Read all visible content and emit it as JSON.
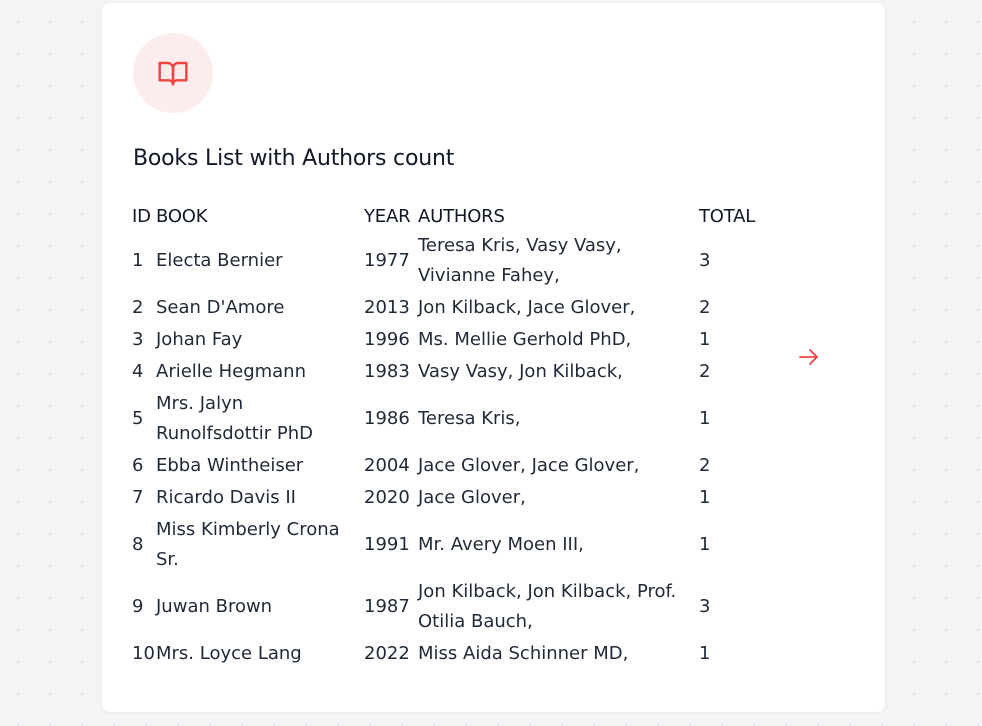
{
  "card": {
    "title": "Books List with Authors count"
  },
  "icons": {
    "header_icon": "book-open-icon",
    "next_icon": "arrow-right-icon"
  },
  "colors": {
    "accent": "#ef4444",
    "icon_bg": "#fdecec",
    "page_bg": "#f3f4f6",
    "card_bg": "#ffffff",
    "text": "#111827"
  },
  "table": {
    "headers": {
      "id": "ID",
      "book": "BOOK",
      "year": "YEAR",
      "authors": "AUTHORS",
      "total": "TOTAL"
    },
    "rows": [
      {
        "id": "1",
        "book": "Electa Bernier",
        "year": "1977",
        "authors": "Teresa Kris, Vasy Vasy, Vivianne Fahey,",
        "total": "3"
      },
      {
        "id": "2",
        "book": "Sean D'Amore",
        "year": "2013",
        "authors": "Jon Kilback, Jace Glover,",
        "total": "2"
      },
      {
        "id": "3",
        "book": "Johan Fay",
        "year": "1996",
        "authors": "Ms. Mellie Gerhold PhD,",
        "total": "1"
      },
      {
        "id": "4",
        "book": "Arielle Hegmann",
        "year": "1983",
        "authors": "Vasy Vasy, Jon Kilback,",
        "total": "2"
      },
      {
        "id": "5",
        "book": "Mrs. Jalyn Runolfsdottir PhD",
        "year": "1986",
        "authors": "Teresa Kris,",
        "total": "1"
      },
      {
        "id": "6",
        "book": "Ebba Wintheiser",
        "year": "2004",
        "authors": "Jace Glover, Jace Glover,",
        "total": "2"
      },
      {
        "id": "7",
        "book": "Ricardo Davis II",
        "year": "2020",
        "authors": "Jace Glover,",
        "total": "1"
      },
      {
        "id": "8",
        "book": "Miss Kimberly Crona Sr.",
        "year": "1991",
        "authors": "Mr. Avery Moen III,",
        "total": "1"
      },
      {
        "id": "9",
        "book": "Juwan Brown",
        "year": "1987",
        "authors": "Jon Kilback, Jon Kilback, Prof. Otilia Bauch,",
        "total": "3"
      },
      {
        "id": "10",
        "book": "Mrs. Loyce Lang",
        "year": "2022",
        "authors": "Miss Aida Schinner MD,",
        "total": "1"
      }
    ]
  }
}
